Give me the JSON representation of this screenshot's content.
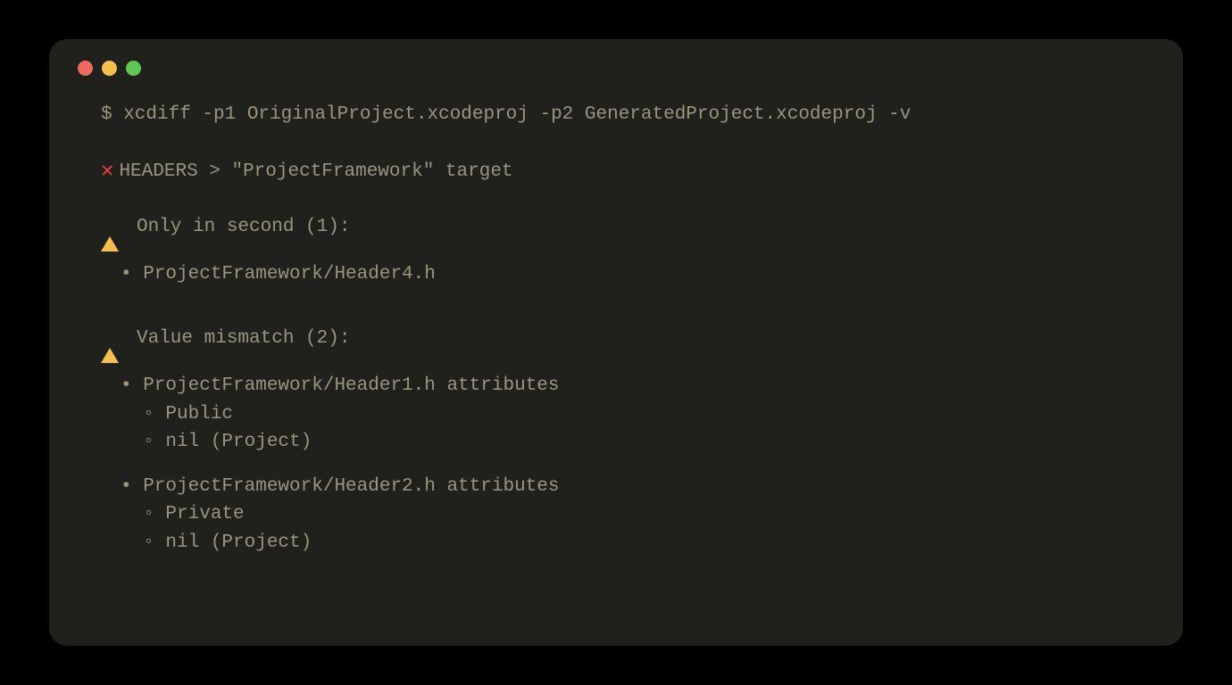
{
  "command": "$ xcdiff -p1 OriginalProject.xcodeproj -p2 GeneratedProject.xcodeproj -v",
  "sections": {
    "headers": {
      "title": "HEADERS > \"ProjectFramework\" target"
    },
    "onlyInSecond": {
      "title": "Only in second (1):",
      "items": {
        "item0": "• ProjectFramework/Header4.h"
      }
    },
    "valueMismatch": {
      "title": "Value mismatch (2):",
      "group1": {
        "header": "• ProjectFramework/Header1.h attributes",
        "sub1": "  ◦ Public",
        "sub2": "  ◦ nil (Project)"
      },
      "group2": {
        "header": "• ProjectFramework/Header2.h attributes",
        "sub1": "  ◦ Private",
        "sub2": "  ◦ nil (Project)"
      }
    }
  }
}
